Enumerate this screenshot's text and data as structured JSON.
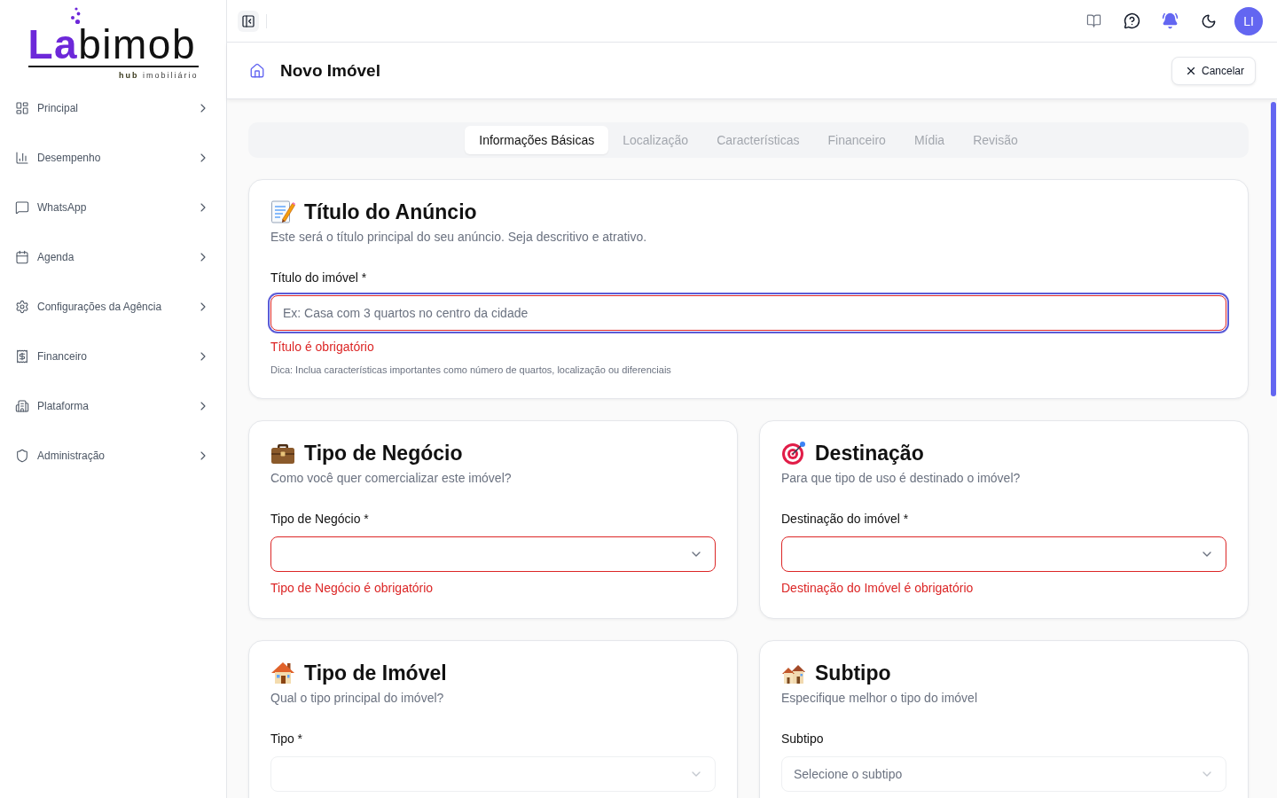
{
  "sidebar": {
    "logo": {
      "accent": "La",
      "rest": "bimob",
      "tagline": "**hub** imobiliário"
    },
    "items": [
      {
        "label": "Principal",
        "selected": false,
        "expanded": false
      },
      {
        "label": "Desempenho",
        "selected": false,
        "expanded": false
      },
      {
        "label": "WhatsApp",
        "selected": false,
        "expanded": false
      },
      {
        "label": "Agenda",
        "selected": false,
        "expanded": false
      },
      {
        "label": "Configurações da Agência",
        "selected": false,
        "expanded": false
      },
      {
        "label": "Financeiro",
        "selected": false,
        "expanded": false
      },
      {
        "label": "Plataforma",
        "selected": false,
        "expanded": false
      },
      {
        "label": "Administração",
        "selected": false,
        "expanded": false
      }
    ]
  },
  "topbar": {
    "avatar": "LI"
  },
  "header": {
    "title": "Novo Imóvel",
    "cancel_button": "Cancelar"
  },
  "tabs": [
    {
      "label": "Informações Básicas",
      "selected": true
    },
    {
      "label": "Localização",
      "selected": false
    },
    {
      "label": "Características",
      "selected": false
    },
    {
      "label": "Financeiro",
      "selected": false
    },
    {
      "label": "Mídia",
      "selected": false
    },
    {
      "label": "Revisão",
      "selected": false
    }
  ],
  "sections": [
    {
      "title": "Título do Anúncio",
      "subtitle": "Este será o título principal do seu anúncio. Seja descritivo e atrativo.",
      "field": {
        "kind": "text",
        "label": "Título do imóvel *",
        "placeholder": "Ex: Casa com 3 quartos no centro da cidade",
        "focused": true,
        "disabled": false,
        "error": "Título é obrigatório",
        "hint": "Dica: Inclua características importantes como número de quartos, localização ou diferenciais"
      }
    },
    {
      "title": "Tipo de Negócio",
      "subtitle": "Como você quer comercializar este imóvel?",
      "field": {
        "kind": "select",
        "label": "Tipo de Negócio *",
        "focused": false,
        "disabled": false,
        "error": "Tipo de Negócio é obrigatório"
      }
    },
    {
      "title": "Destinação",
      "subtitle": "Para que tipo de uso é destinado o imóvel?",
      "field": {
        "kind": "select",
        "label": "Destinação do imóvel *",
        "focused": false,
        "disabled": false,
        "error": "Destinação do Imóvel é obrigatório"
      }
    },
    {
      "title": "Tipo de Imóvel",
      "subtitle": "Qual o tipo principal do imóvel?",
      "field": {
        "kind": "select",
        "label": "Tipo *",
        "focused": false,
        "disabled": true
      }
    },
    {
      "title": "Subtipo",
      "subtitle": "Especifique melhor o tipo do imóvel",
      "field": {
        "kind": "select",
        "label": "Subtipo",
        "placeholder": "Selecione o subtipo",
        "focused": false,
        "disabled": true
      }
    }
  ]
}
